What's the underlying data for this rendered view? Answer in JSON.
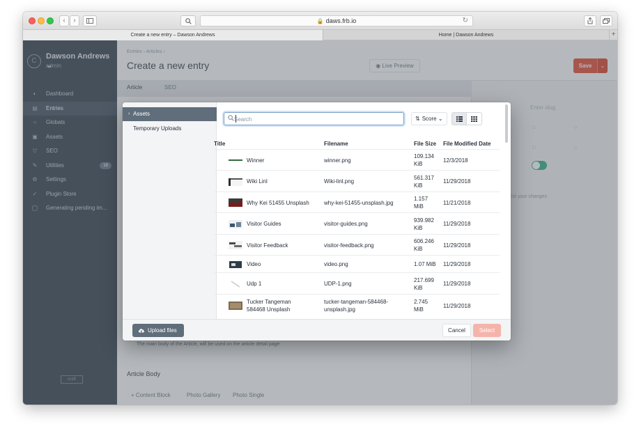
{
  "browser": {
    "url": "daws.frb.io",
    "tabs": [
      {
        "label": "Create a new entry – Dawson Andrews"
      },
      {
        "label": "Home | Dawson Andrews"
      }
    ],
    "new_tab": "+"
  },
  "sidebar": {
    "avatar_letter": "C",
    "user_name": "Dawson Andrews ⌄",
    "user_role": "admin",
    "items": [
      {
        "label": "Dashboard",
        "icon": "gauge-icon"
      },
      {
        "label": "Entries",
        "icon": "entries-icon"
      },
      {
        "label": "Globals",
        "icon": "globe-icon"
      },
      {
        "label": "Assets",
        "icon": "image-icon"
      },
      {
        "label": "SEO",
        "icon": "seo-icon"
      },
      {
        "label": "Utilities",
        "icon": "wrench-icon",
        "badge": "18"
      },
      {
        "label": "Settings",
        "icon": "gear-icon"
      },
      {
        "label": "Plugin Store",
        "icon": "plug-icon"
      },
      {
        "label": "Generating pending im...",
        "icon": "spinner-icon"
      }
    ],
    "footer_logo": "craft"
  },
  "page": {
    "breadcrumb": "Entries › Articles ›",
    "title": "Create a new entry",
    "live_preview": "Live Preview",
    "save": "Save",
    "tabs": [
      "Article",
      "SEO"
    ],
    "slug_placeholder": "Enter slug",
    "changes_note": "ist your changes",
    "field_instructions": "The main body of the Article, will be used on the article detail page",
    "field_heading": "Article Body",
    "block_types": [
      "+ Content Block",
      "Photo Gallery",
      "Photo Single"
    ]
  },
  "modal": {
    "sources": [
      {
        "label": "Assets",
        "selected": true
      },
      {
        "label": "Temporary Uploads",
        "selected": false
      }
    ],
    "search_placeholder": "Search",
    "search_value": "",
    "sort_label": "Score",
    "columns": [
      "Title",
      "Filename",
      "File Size",
      "File Modified Date"
    ],
    "rows": [
      {
        "title": [
          "Winner"
        ],
        "filename": [
          "winner.png"
        ],
        "size": [
          "109.134",
          "KiB"
        ],
        "date": "12/3/2018"
      },
      {
        "title": [
          "Wiki Linl"
        ],
        "filename": [
          "Wiki-linl.png"
        ],
        "size": [
          "561.317",
          "KiB"
        ],
        "date": "11/29/2018"
      },
      {
        "title": [
          "Why Kei 51455 Unsplash"
        ],
        "filename": [
          "why-kei-51455-unsplash.jpg"
        ],
        "size": [
          "1.157",
          "MiB"
        ],
        "date": "11/21/2018"
      },
      {
        "title": [
          "Visitor Guides"
        ],
        "filename": [
          "visitor-guides.png"
        ],
        "size": [
          "939.982",
          "KiB"
        ],
        "date": "11/29/2018"
      },
      {
        "title": [
          "Visitor Feedback"
        ],
        "filename": [
          "visitor-feedback.png"
        ],
        "size": [
          "606.246",
          "KiB"
        ],
        "date": "11/29/2018"
      },
      {
        "title": [
          "Video"
        ],
        "filename": [
          "video.png"
        ],
        "size": [
          "1.07 MiB"
        ],
        "date": "11/29/2018"
      },
      {
        "title": [
          "Udp 1"
        ],
        "filename": [
          "UDP-1.png"
        ],
        "size": [
          "217.699",
          "KiB"
        ],
        "date": "11/29/2018"
      },
      {
        "title": [
          "Tucker Tangeman",
          "584468 Unsplash"
        ],
        "filename": [
          "tucker-tangeman-584468-",
          "unsplash.jpg"
        ],
        "size": [
          "2.745",
          "MiB"
        ],
        "date": "11/29/2018"
      }
    ],
    "upload_label": "Upload files",
    "cancel_label": "Cancel",
    "select_label": "Select"
  },
  "colors": {
    "accent_red": "#e5422b",
    "sidebar": "#2b3643",
    "selected_source": "#606d7a",
    "toggle_green": "#27ab83"
  }
}
